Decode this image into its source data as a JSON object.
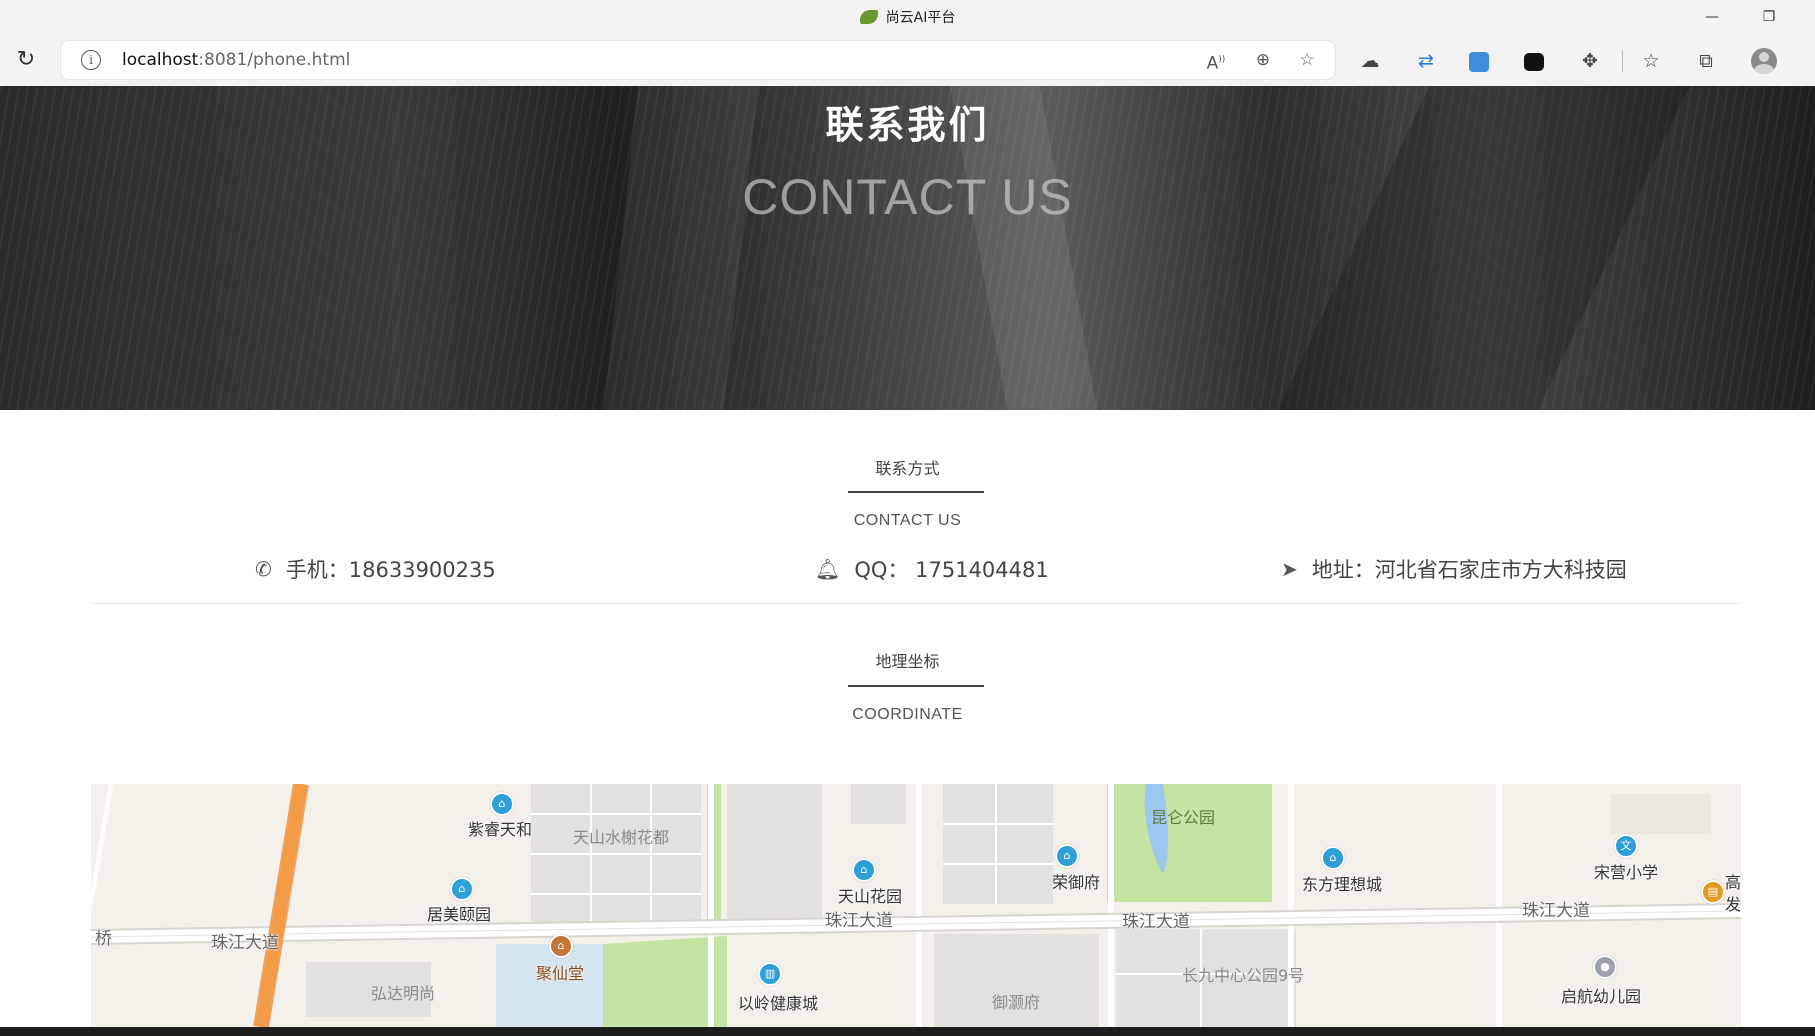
{
  "browser": {
    "tab_title": "尚云AI平台",
    "url_host": "localhost",
    "url_rest": ":8081/phone.html"
  },
  "hero": {
    "title_cn": "联系我们",
    "title_en": "CONTACT US"
  },
  "contact": {
    "heading_cn": "联系方式",
    "heading_en": "CONTACT US",
    "phone": "手机：18633900235",
    "qq": "QQ：  1751404481",
    "address": "地址：河北省石家庄市方大科技园"
  },
  "coordinate": {
    "heading_cn": "地理坐标",
    "heading_en": "COORDINATE"
  },
  "map": {
    "labels": {
      "zirui": "紫睿天和",
      "tianshan_shuixie": "天山水榭花都",
      "juemei": "居美颐园",
      "tianshan_huayuan": "天山花园",
      "rongyu": "荣御府",
      "kunlun_park": "昆仑公园",
      "dongfang": "东方理想城",
      "songying": "宋营小学",
      "zhujiang1": "珠江大道",
      "zhujiang2": "珠江大道",
      "zhujiang3": "珠江大道",
      "zhujiang4": "珠江大道",
      "qiao": "桥",
      "juxiantang": "聚仙堂",
      "hongda": "弘达明尚",
      "yiling": "以岭健康城",
      "yuyuan": "御灏府",
      "changjiu": "长九中心公园9号",
      "qihang": "启航幼儿园",
      "edge1": "高",
      "edge2": "发"
    }
  },
  "colors": {
    "hero_text": "#ffffff",
    "map_bg": "#f4f1ea",
    "park_green": "#c5e3a2",
    "road_orange": "#f49b48",
    "poi_blue": "#2f9fd8"
  }
}
